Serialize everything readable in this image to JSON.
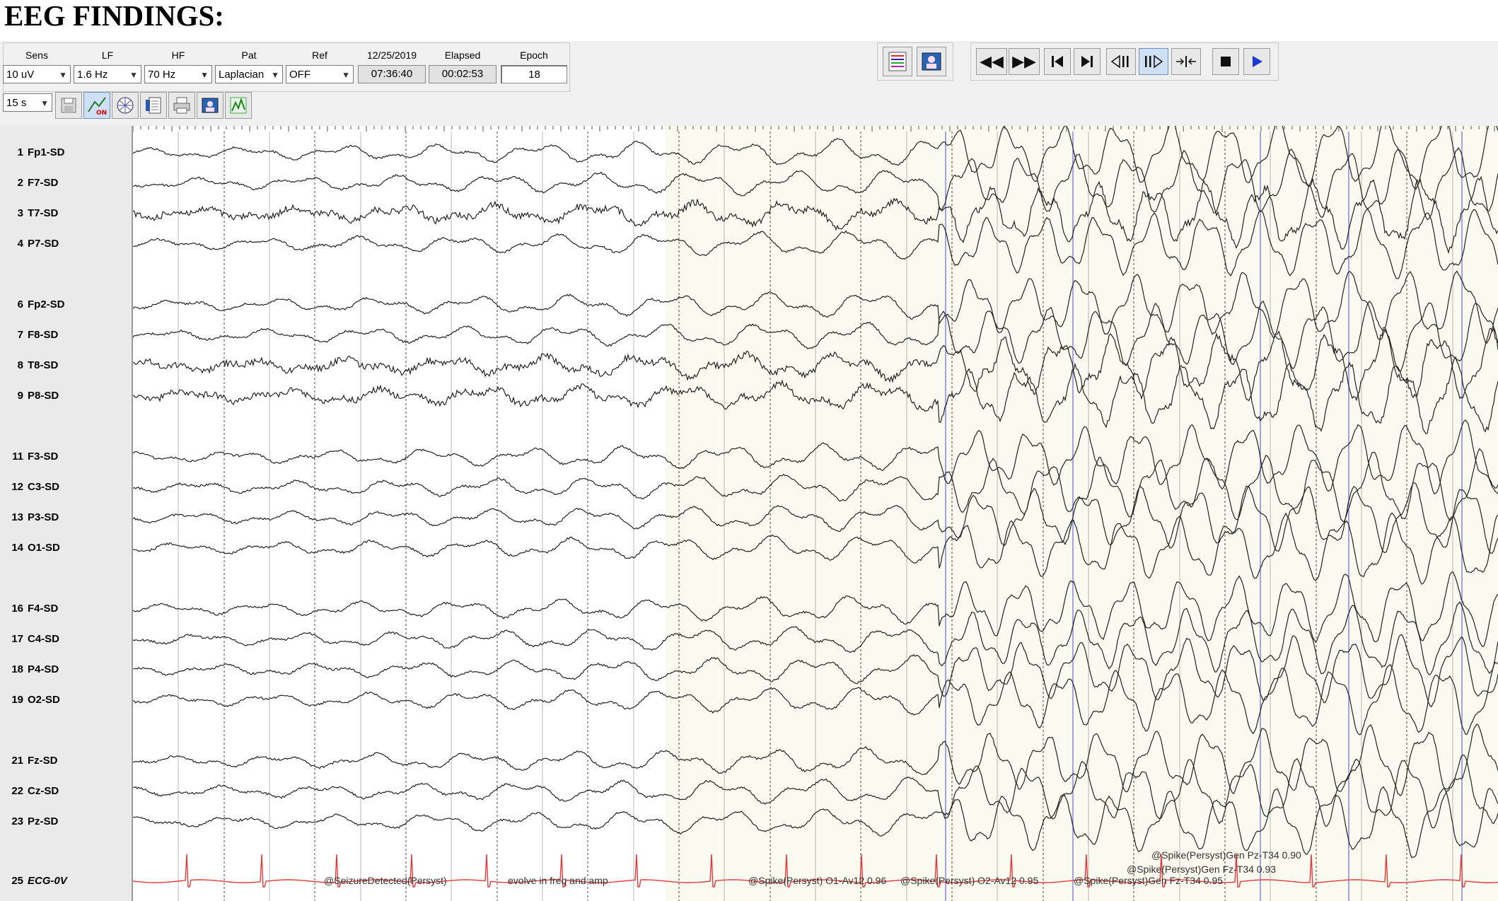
{
  "heading": "EEG FINDINGS:",
  "controls": {
    "sens": {
      "label": "Sens",
      "value": "10 uV"
    },
    "lf": {
      "label": "LF",
      "value": "1.6 Hz"
    },
    "hf": {
      "label": "HF",
      "value": "70 Hz"
    },
    "pat": {
      "label": "Pat",
      "value": "Laplacian"
    },
    "ref": {
      "label": "Ref",
      "value": "OFF"
    },
    "date": "12/25/2019",
    "time": "07:36:40",
    "elapsed": {
      "label": "Elapsed",
      "value": "00:02:53"
    },
    "epoch": {
      "label": "Epoch",
      "value": "18"
    },
    "timebase": "15 s"
  },
  "toolbar_icons": [
    "save-icon",
    "review-on-icon",
    "head-map-icon",
    "patient-info-icon",
    "print-icon",
    "video-icon",
    "trend-icon"
  ],
  "top_icons": [
    "montage-list-icon",
    "video-window-icon"
  ],
  "playback_buttons": [
    "fast-rewind",
    "fast-forward",
    "go-to-start",
    "go-to-end",
    "step-back",
    "step-forward",
    "collapse",
    "stop",
    "play"
  ],
  "channels": [
    {
      "num": "1",
      "name": "Fp1-SD"
    },
    {
      "num": "2",
      "name": "F7-SD"
    },
    {
      "num": "3",
      "name": "T7-SD"
    },
    {
      "num": "4",
      "name": "P7-SD"
    },
    {
      "num": "6",
      "name": "Fp2-SD"
    },
    {
      "num": "7",
      "name": "F8-SD"
    },
    {
      "num": "8",
      "name": "T8-SD"
    },
    {
      "num": "9",
      "name": "P8-SD"
    },
    {
      "num": "11",
      "name": "F3-SD"
    },
    {
      "num": "12",
      "name": "C3-SD"
    },
    {
      "num": "13",
      "name": "P3-SD"
    },
    {
      "num": "14",
      "name": "O1-SD"
    },
    {
      "num": "16",
      "name": "F4-SD"
    },
    {
      "num": "17",
      "name": "C4-SD"
    },
    {
      "num": "18",
      "name": "P4-SD"
    },
    {
      "num": "19",
      "name": "O2-SD"
    },
    {
      "num": "21",
      "name": "Fz-SD"
    },
    {
      "num": "22",
      "name": "Cz-SD"
    },
    {
      "num": "23",
      "name": "Pz-SD"
    },
    {
      "num": "25",
      "name": "ECG-0V",
      "italic": true
    }
  ],
  "annotations": [
    "@SeizureDetected(Persyst)",
    "evolve in freq and amp",
    "@Spike(Persyst) O1-Av12 0.96",
    "@Spike(Persyst) O2-Av12 0.95",
    "@Spike(Persyst)Gen Fz-T34 0.95",
    "@Spike(Persyst)Gen Fz-T34 0.93",
    "@Spike(Persyst)Gen Pz-T34 0.90"
  ],
  "colors": {
    "ecg": "#e23a3a",
    "trace": "#222222",
    "dotted_grid": "#444444",
    "marker": "#6a6ad8",
    "highlight": "#fbfaf0"
  },
  "seizure_onset_fraction": 0.59
}
